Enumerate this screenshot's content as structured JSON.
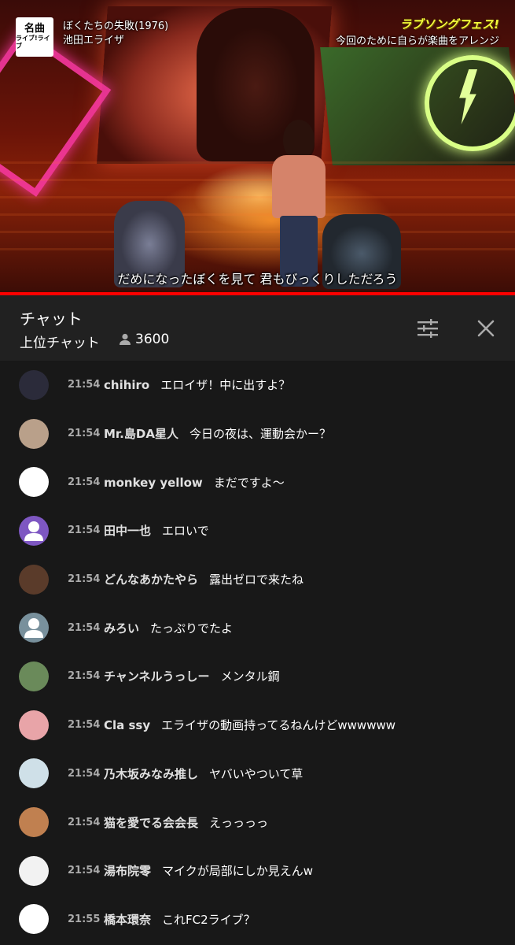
{
  "video": {
    "logo_line1": "名曲",
    "logo_line2": "ライブ!ライブ",
    "song_title": "ぼくたちの失敗(1976)",
    "artist": "池田エライザ",
    "show_title": "ラブソングフェス!",
    "show_subtitle": "今回のために自らが楽曲をアレンジ",
    "subtitle": "だめになったぼくを見て 君もびっくりしただろう",
    "progress": 1.0
  },
  "chat_header": {
    "title": "チャット",
    "mode": "上位チャット",
    "viewers": "3600",
    "tune_icon": "tune-icon",
    "close_icon": "close-icon"
  },
  "messages": [
    {
      "time": "21:54",
      "author": "chihiro",
      "text": "エロイザ！中に出すよ？",
      "avatar_color": "#2b2b3a"
    },
    {
      "time": "21:54",
      "author": "Mr.島DA星人",
      "text": "今日の夜は、運動会かー？",
      "avatar_color": "#b9a08a"
    },
    {
      "time": "21:54",
      "author": "monkey yellow",
      "text": "まだですよ〜",
      "avatar_color": "#ffffff"
    },
    {
      "time": "21:54",
      "author": "田中一也",
      "text": "エロいで",
      "avatar_color": "#7e57c2"
    },
    {
      "time": "21:54",
      "author": "どんなあかたやら",
      "text": "露出ゼロで来たね",
      "avatar_color": "#5a3b2a"
    },
    {
      "time": "21:54",
      "author": "みろい",
      "text": "たっぷりでたよ",
      "avatar_color": "#78909c"
    },
    {
      "time": "21:54",
      "author": "チャンネルうっしー",
      "text": "メンタル鋼",
      "avatar_color": "#6a8a5a"
    },
    {
      "time": "21:54",
      "author": "Cla ssy",
      "text": "エライザの動画持ってるねんけどwwwwww",
      "avatar_color": "#e8a4a8"
    },
    {
      "time": "21:54",
      "author": "乃木坂みなみ推し",
      "text": "ヤバいやついて草",
      "avatar_color": "#cfe0e8"
    },
    {
      "time": "21:54",
      "author": "猫を愛でる会会長",
      "text": "えっっっっ",
      "avatar_color": "#c08050"
    },
    {
      "time": "21:54",
      "author": "湯布院零",
      "text": "マイクが局部にしか見えんw",
      "avatar_color": "#f2f2f2"
    },
    {
      "time": "21:55",
      "author": "橋本環奈",
      "text": "これFC2ライブ？",
      "avatar_color": "#ffffff"
    }
  ]
}
